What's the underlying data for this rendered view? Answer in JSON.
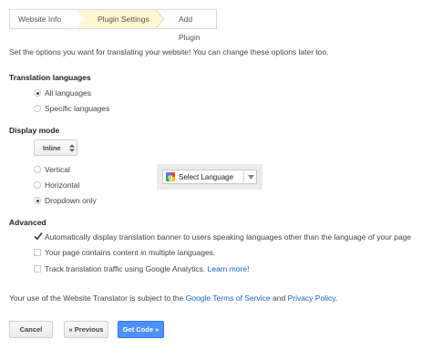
{
  "steps": [
    {
      "label": "Website Info",
      "active": false
    },
    {
      "label": "Plugin Settings",
      "active": true
    },
    {
      "label": "Add Plugin",
      "active": false
    }
  ],
  "intro": "Set the options you want for translating your website! You can change these options later too.",
  "translation_languages": {
    "heading": "Translation languages",
    "options": [
      {
        "label": "All languages",
        "selected": true
      },
      {
        "label": "Specific languages",
        "selected": false
      }
    ]
  },
  "display_mode": {
    "heading": "Display mode",
    "select_value": "Inline",
    "options": [
      {
        "label": "Vertical",
        "selected": false
      },
      {
        "label": "Horizontal",
        "selected": false
      },
      {
        "label": "Dropdown only",
        "selected": true
      }
    ],
    "preview_label": "Select Language"
  },
  "advanced": {
    "heading": "Advanced",
    "options": [
      {
        "label": "Automatically display translation banner to users speaking languages other than the language of your page",
        "checked": true
      },
      {
        "label": "Your page contains content in multiple languages.",
        "checked": false
      },
      {
        "label": "Track translation traffic using Google Analytics.",
        "checked": false,
        "link": "Learn more!"
      }
    ]
  },
  "terms": {
    "prefix": "Your use of the Website Translator is subject to the ",
    "tos_link": "Google Terms of Service",
    "middle": " and ",
    "privacy_link": "Privacy Policy",
    "suffix": "."
  },
  "buttons": {
    "cancel": "Cancel",
    "previous": "« Previous",
    "get_code": "Get Code »"
  },
  "colors": {
    "active_step": "#fff7d1",
    "link": "#1a5fcc",
    "primary_button": "#4d90fe"
  }
}
